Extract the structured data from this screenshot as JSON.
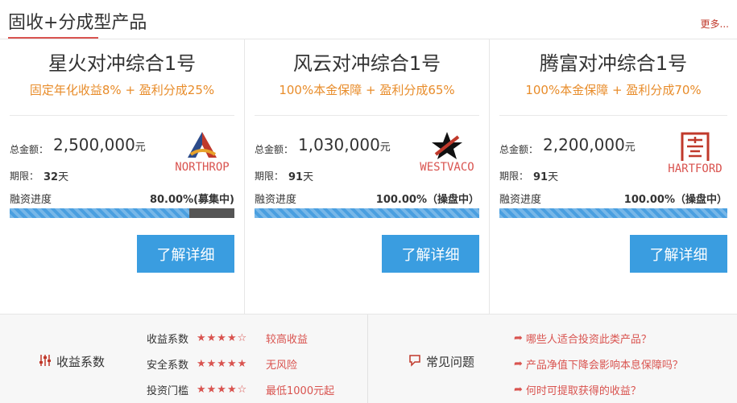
{
  "header": {
    "title": "固收+分成型产品",
    "more": "更多..."
  },
  "labels": {
    "amount": "总金额：",
    "term": "期限：",
    "progress": "融资进度",
    "amount_unit": "元",
    "term_unit": "天"
  },
  "cards": [
    {
      "name": "星火对冲综合1号",
      "sub": "固定年化收益8% + 盈利分成25%",
      "amount": "2,500,000",
      "term": "32",
      "logo_text": "NORTHROP",
      "logo_icon": "northrop-logo-icon",
      "progress_text": "80.00%(募集中)",
      "progress": 0.8,
      "button": "了解详细"
    },
    {
      "name": "风云对冲综合1号",
      "sub": "100%本金保障 + 盈利分成65%",
      "amount": "1,030,000",
      "term": "91",
      "logo_text": "WESTVACO",
      "logo_icon": "westvaco-star-icon",
      "progress_text": "100.00%（操盘中）",
      "progress": 1.0,
      "button": "了解详细"
    },
    {
      "name": "腾富对冲综合1号",
      "sub": "100%本金保障 + 盈利分成70%",
      "amount": "2,200,000",
      "term": "91",
      "logo_text": "HARTFORD",
      "logo_icon": "hartford-logo-icon",
      "progress_text": "100.00%（操盘中）",
      "progress": 1.0,
      "button": "了解详细"
    }
  ],
  "footer": {
    "coef_title": "收益系数",
    "coef_rows": [
      {
        "label": "收益系数",
        "stars": "★★★★☆",
        "desc": "较高收益"
      },
      {
        "label": "安全系数",
        "stars": "★★★★★",
        "desc": "无风险"
      },
      {
        "label": "投资门槛",
        "stars": "★★★★☆",
        "desc": "最低1000元起"
      }
    ],
    "faq_title": "常见问题",
    "faqs": [
      "哪些人适合投资此类产品？",
      "产品净值下降会影响本息保障吗？",
      "何时可提取获得的收益？"
    ]
  },
  "colors": {
    "accent": "#d9534f",
    "orange": "#e88c2a",
    "button": "#3a9de0",
    "bar": "#4a9fe0"
  }
}
